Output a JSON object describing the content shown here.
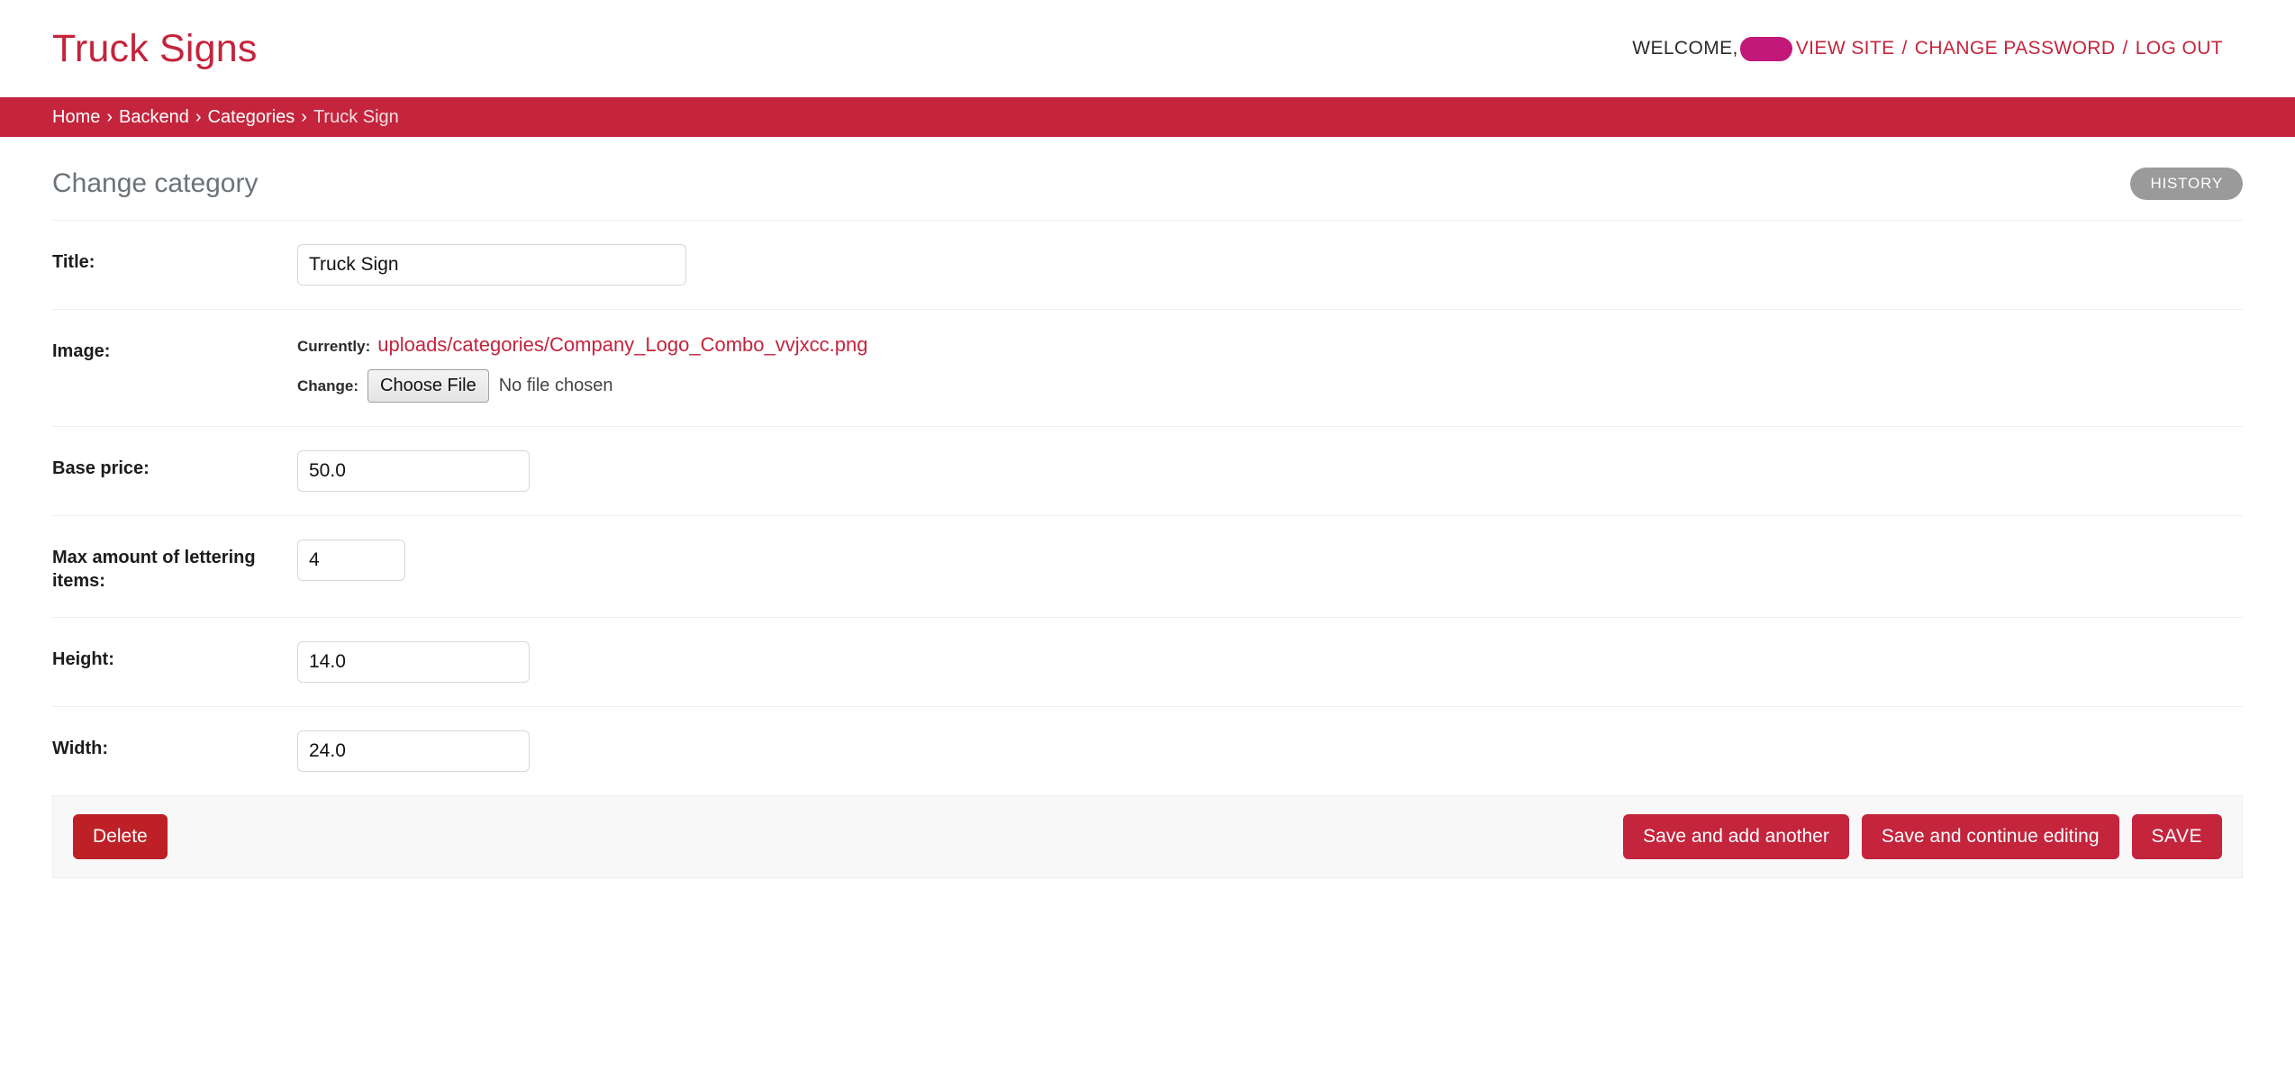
{
  "header": {
    "branding": "Truck Signs",
    "welcome_label": "WELCOME,",
    "username_redacted": true,
    "links": {
      "view_site": "VIEW SITE",
      "change_password": "CHANGE PASSWORD",
      "log_out": "LOG OUT"
    },
    "separator": "/"
  },
  "breadcrumbs": {
    "separator": "›",
    "items": [
      {
        "label": "Home",
        "current": false
      },
      {
        "label": "Backend",
        "current": false
      },
      {
        "label": "Categories",
        "current": false
      },
      {
        "label": "Truck Sign",
        "current": true
      }
    ]
  },
  "content": {
    "page_title": "Change category",
    "history_button": "HISTORY"
  },
  "form": {
    "title_field": {
      "label": "Title:",
      "value": "Truck Sign"
    },
    "image_field": {
      "label": "Image:",
      "currently_label": "Currently:",
      "currently_value": "uploads/categories/Company_Logo_Combo_vvjxcc.png",
      "change_label": "Change:",
      "choose_file_button": "Choose File",
      "no_file_text": "No file chosen"
    },
    "base_price_field": {
      "label": "Base price:",
      "value": "50.0"
    },
    "max_lettering_field": {
      "label": "Max amount of lettering items:",
      "value": "4"
    },
    "height_field": {
      "label": "Height:",
      "value": "14.0"
    },
    "width_field": {
      "label": "Width:",
      "value": "24.0"
    }
  },
  "submit_row": {
    "delete_label": "Delete",
    "save_add_another_label": "Save and add another",
    "save_continue_label": "Save and continue editing",
    "save_label": "SAVE"
  },
  "colors": {
    "brand_red": "#c4243c",
    "delete_red": "#bd2026",
    "redaction_magenta": "#c2187a",
    "history_grey": "#9a9a9a",
    "title_grey": "#6b7279"
  }
}
